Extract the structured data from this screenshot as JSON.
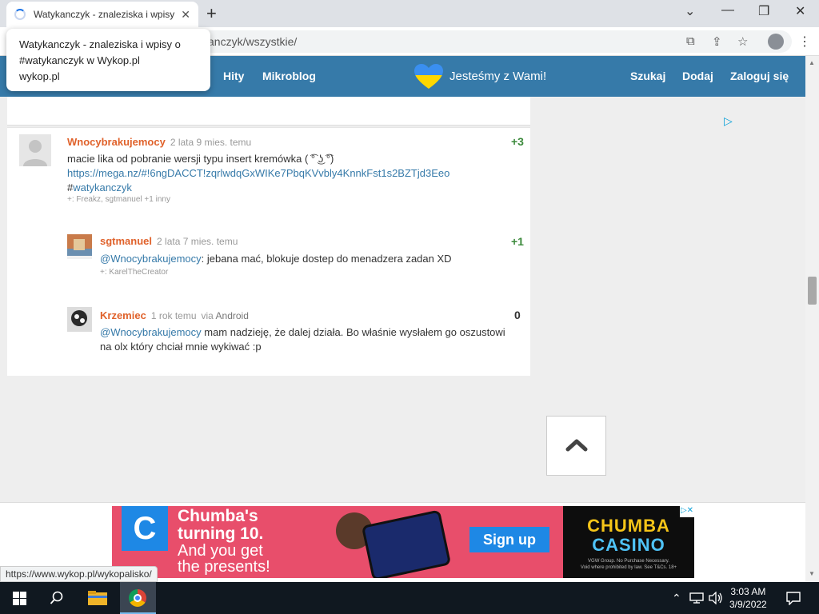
{
  "browser": {
    "tab_title": "Watykanczyk - znaleziska i wpisy",
    "url_visible": "anczyk/wszystkie/",
    "tooltip_line1": "Watykanczyk - znaleziska i wpisy o",
    "tooltip_line2": "#watykanczyk w Wykop.pl",
    "tooltip_domain": "wykop.pl",
    "status_url": "https://www.wykop.pl/wykopalisko/"
  },
  "nav": {
    "hity": "Hity",
    "mikroblog": "Mikroblog",
    "solidarity": "Jesteśmy z Wami!",
    "szukaj": "Szukaj",
    "dodaj": "Dodaj",
    "zaloguj": "Zaloguj się",
    "heart_colors": [
      "#3a8ff0",
      "#ffd700"
    ]
  },
  "comments": [
    {
      "author": "Wnocybrakujemocy",
      "time": "2 lata 9 mies. temu",
      "score": "+3",
      "text": "macie lika od pobranie wersji typu insert kremówka ( ͡° ͜ʖ ͡°)",
      "link": "https://mega.nz/#!6ngDACCT!zqrlwdqGxWIKe7PbqKVvbly4KnnkFst1s2BZTjd3Eeo",
      "hash": "#",
      "tag": "watykanczyk",
      "votes": "+: Freakz, sgtmanuel +1 inny"
    },
    {
      "author": "sgtmanuel",
      "time": "2 lata 7 mies. temu",
      "score": "+1",
      "mention": "@Wnocybrakujemocy",
      "text": ": jebana mać, blokuje dostep do menadzera zadan XD",
      "votes": "+: KarelTheCreator"
    },
    {
      "author": "Krzemiec",
      "time": "1 rok temu",
      "via_label": "via",
      "via": "Android",
      "score": "0",
      "mention": "@Wnocybrakujemocy",
      "text_line1": " mam nadzieję, że dalej działa. Bo właśnie wysłałem go oszustowi",
      "text_line2": "na olx który chciał mnie wykiwać :p"
    }
  ],
  "ad": {
    "headline_line1": "Chumba's",
    "headline_line2": "turning 10.",
    "sub_line1": "And you get",
    "sub_line2": "the presents!",
    "cta": "Sign up",
    "brand_line1": "CHUMBA",
    "brand_line2": "CASINO",
    "fine_line1": "VGW Group. No Purchase Necessary.",
    "fine_line2": "Void where prohibited by law. See T&Cs. 18+"
  },
  "taskbar": {
    "time": "3:03 AM",
    "date": "3/9/2022"
  },
  "colors": {
    "nav_blue": "#367aa9",
    "author_orange": "#e0622b",
    "score_green": "#3c8a3c",
    "link_blue": "#367aa9"
  }
}
